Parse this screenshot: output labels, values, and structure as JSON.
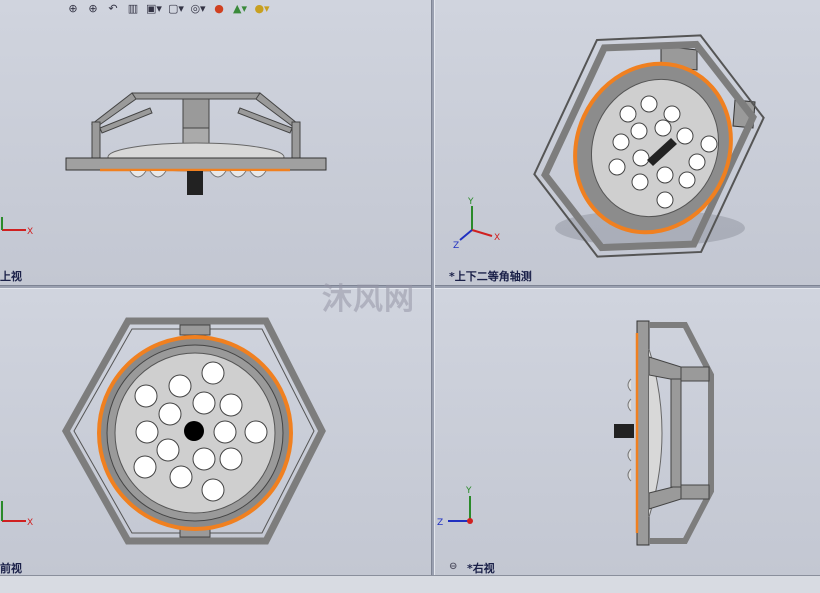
{
  "views": {
    "top": "上视",
    "trimetric": "*上下二等角轴测",
    "front": "前视",
    "right": "*右视"
  },
  "triad": {
    "x": "X",
    "y": "Y",
    "z": "Z"
  },
  "watermark": "沐风网",
  "toolbar": {
    "zoom_fit": "⊕",
    "zoom_area": "⊕",
    "prev_view": "↶",
    "section_view": "▥",
    "view_orientation": "▣▾",
    "display_style": "▢▾",
    "hide_show": "◎▾",
    "edit_appearance": "●",
    "apply_scene": "▲▾",
    "view_settings": "●▾"
  },
  "colors": {
    "frame": "#8a8a8a",
    "frame_dark": "#5a5a5a",
    "ring": "#f08020",
    "lens": "#ffffff",
    "body": "#a8a8a8"
  }
}
